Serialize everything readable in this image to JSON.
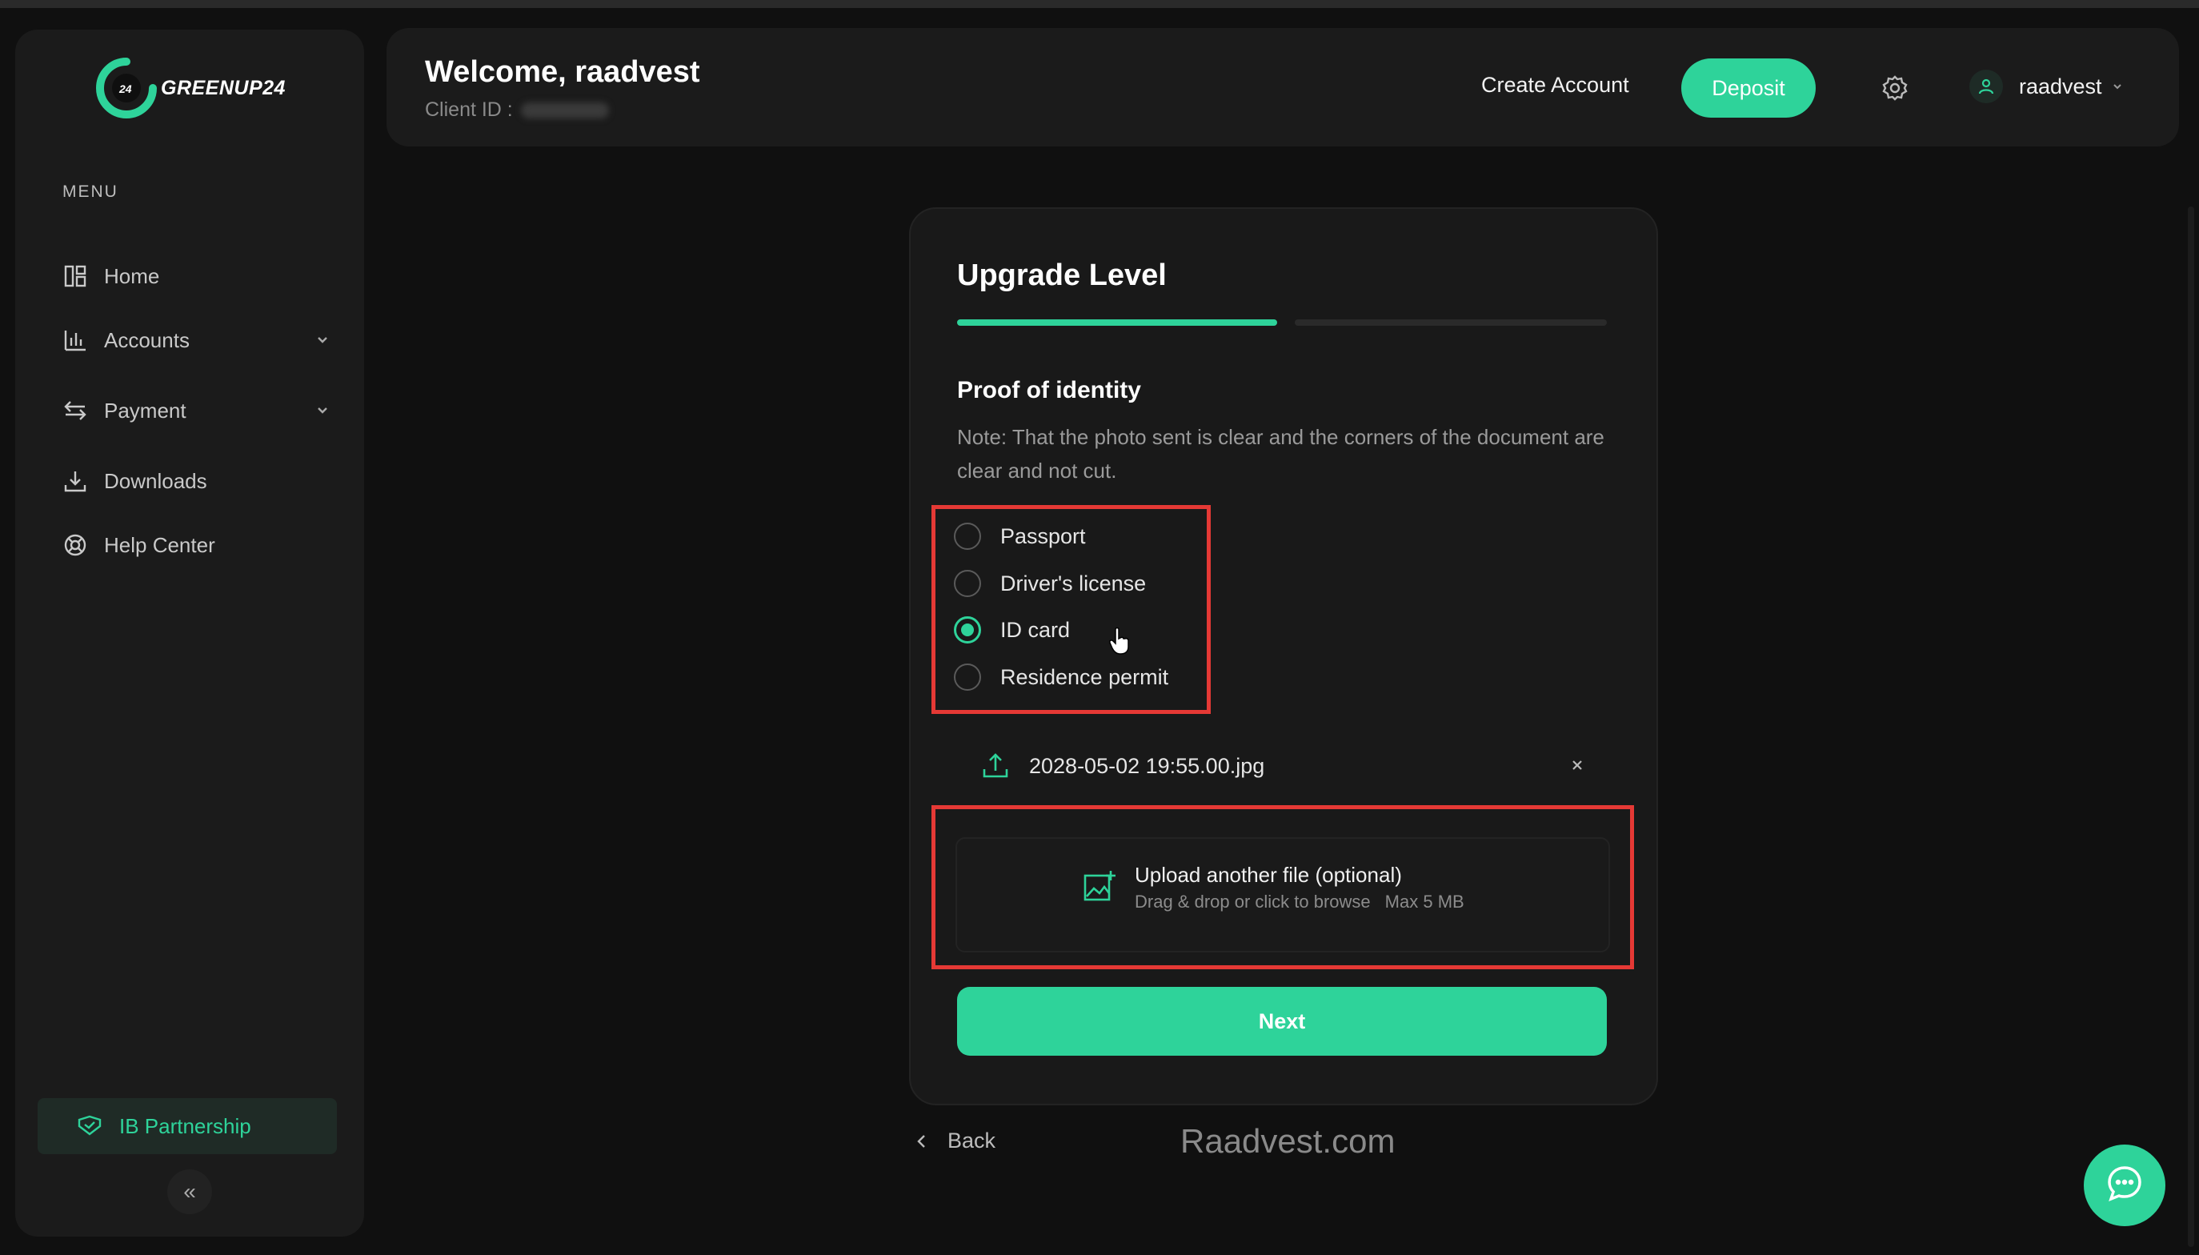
{
  "brand": {
    "name": "GREENUP24",
    "accent": "#2ed39a"
  },
  "sidebar": {
    "menu_title": "MENU",
    "items": [
      {
        "label": "Home",
        "icon": "grid-icon"
      },
      {
        "label": "Accounts",
        "icon": "bar-chart-icon"
      },
      {
        "label": "Payment",
        "icon": "transfer-icon"
      },
      {
        "label": "Downloads",
        "icon": "download-icon"
      },
      {
        "label": "Help Center",
        "icon": "lifebuoy-icon"
      }
    ],
    "ib_label": "IB Partnership",
    "collapse_label": "«"
  },
  "header": {
    "welcome": "Welcome, raadvest",
    "client_id_label": "Client ID :",
    "create_account": "Create Account",
    "deposit": "Deposit",
    "username": "raadvest"
  },
  "card": {
    "title": "Upgrade Level",
    "progress": 0.5,
    "section_title": "Proof of identity",
    "note": "Note: That the photo sent is clear and the corners of the document are clear and not cut.",
    "options": [
      {
        "label": "Passport",
        "checked": false
      },
      {
        "label": "Driver's license",
        "checked": false
      },
      {
        "label": "ID card",
        "checked": true
      },
      {
        "label": "Residence permit",
        "checked": false
      }
    ],
    "uploaded_file": "2028-05-02 19:55.00.jpg",
    "upload": {
      "title": "Upload another file (optional)",
      "hint": "Drag & drop or click to browse",
      "max": "Max 5 MB"
    },
    "next": "Next"
  },
  "back": "Back",
  "watermark": "Raadvest.com",
  "colors": {
    "background": "#101010",
    "panel": "#1b1b1b",
    "highlight_box": "#e53935"
  }
}
